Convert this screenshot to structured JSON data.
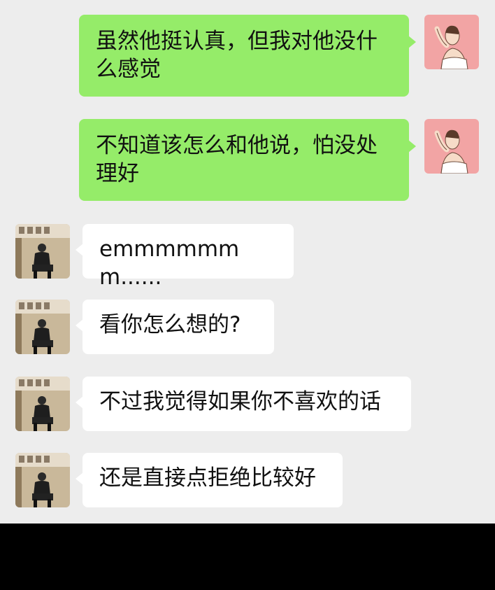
{
  "conversation": {
    "sent_messages": [
      {
        "text": "虽然他挺认真，但我对他没什么感觉"
      },
      {
        "text": "不知道该怎么和他说，怕没处理好"
      }
    ],
    "received_messages": [
      {
        "text": "emmmmmmm......"
      },
      {
        "text": "看你怎么想的?"
      },
      {
        "text": "不过我觉得如果你不喜欢的话"
      },
      {
        "text": "还是直接点拒绝比较好"
      }
    ]
  },
  "colors": {
    "chat_background": "#ededed",
    "sent_bubble": "#95ec69",
    "received_bubble": "#ffffff",
    "sent_avatar_bg": "#f2a4a4",
    "bottom_bar": "#000000"
  },
  "icons": {
    "sent_avatar": "woman-illustration-avatar",
    "received_avatar": "man-sitting-photo-avatar"
  }
}
